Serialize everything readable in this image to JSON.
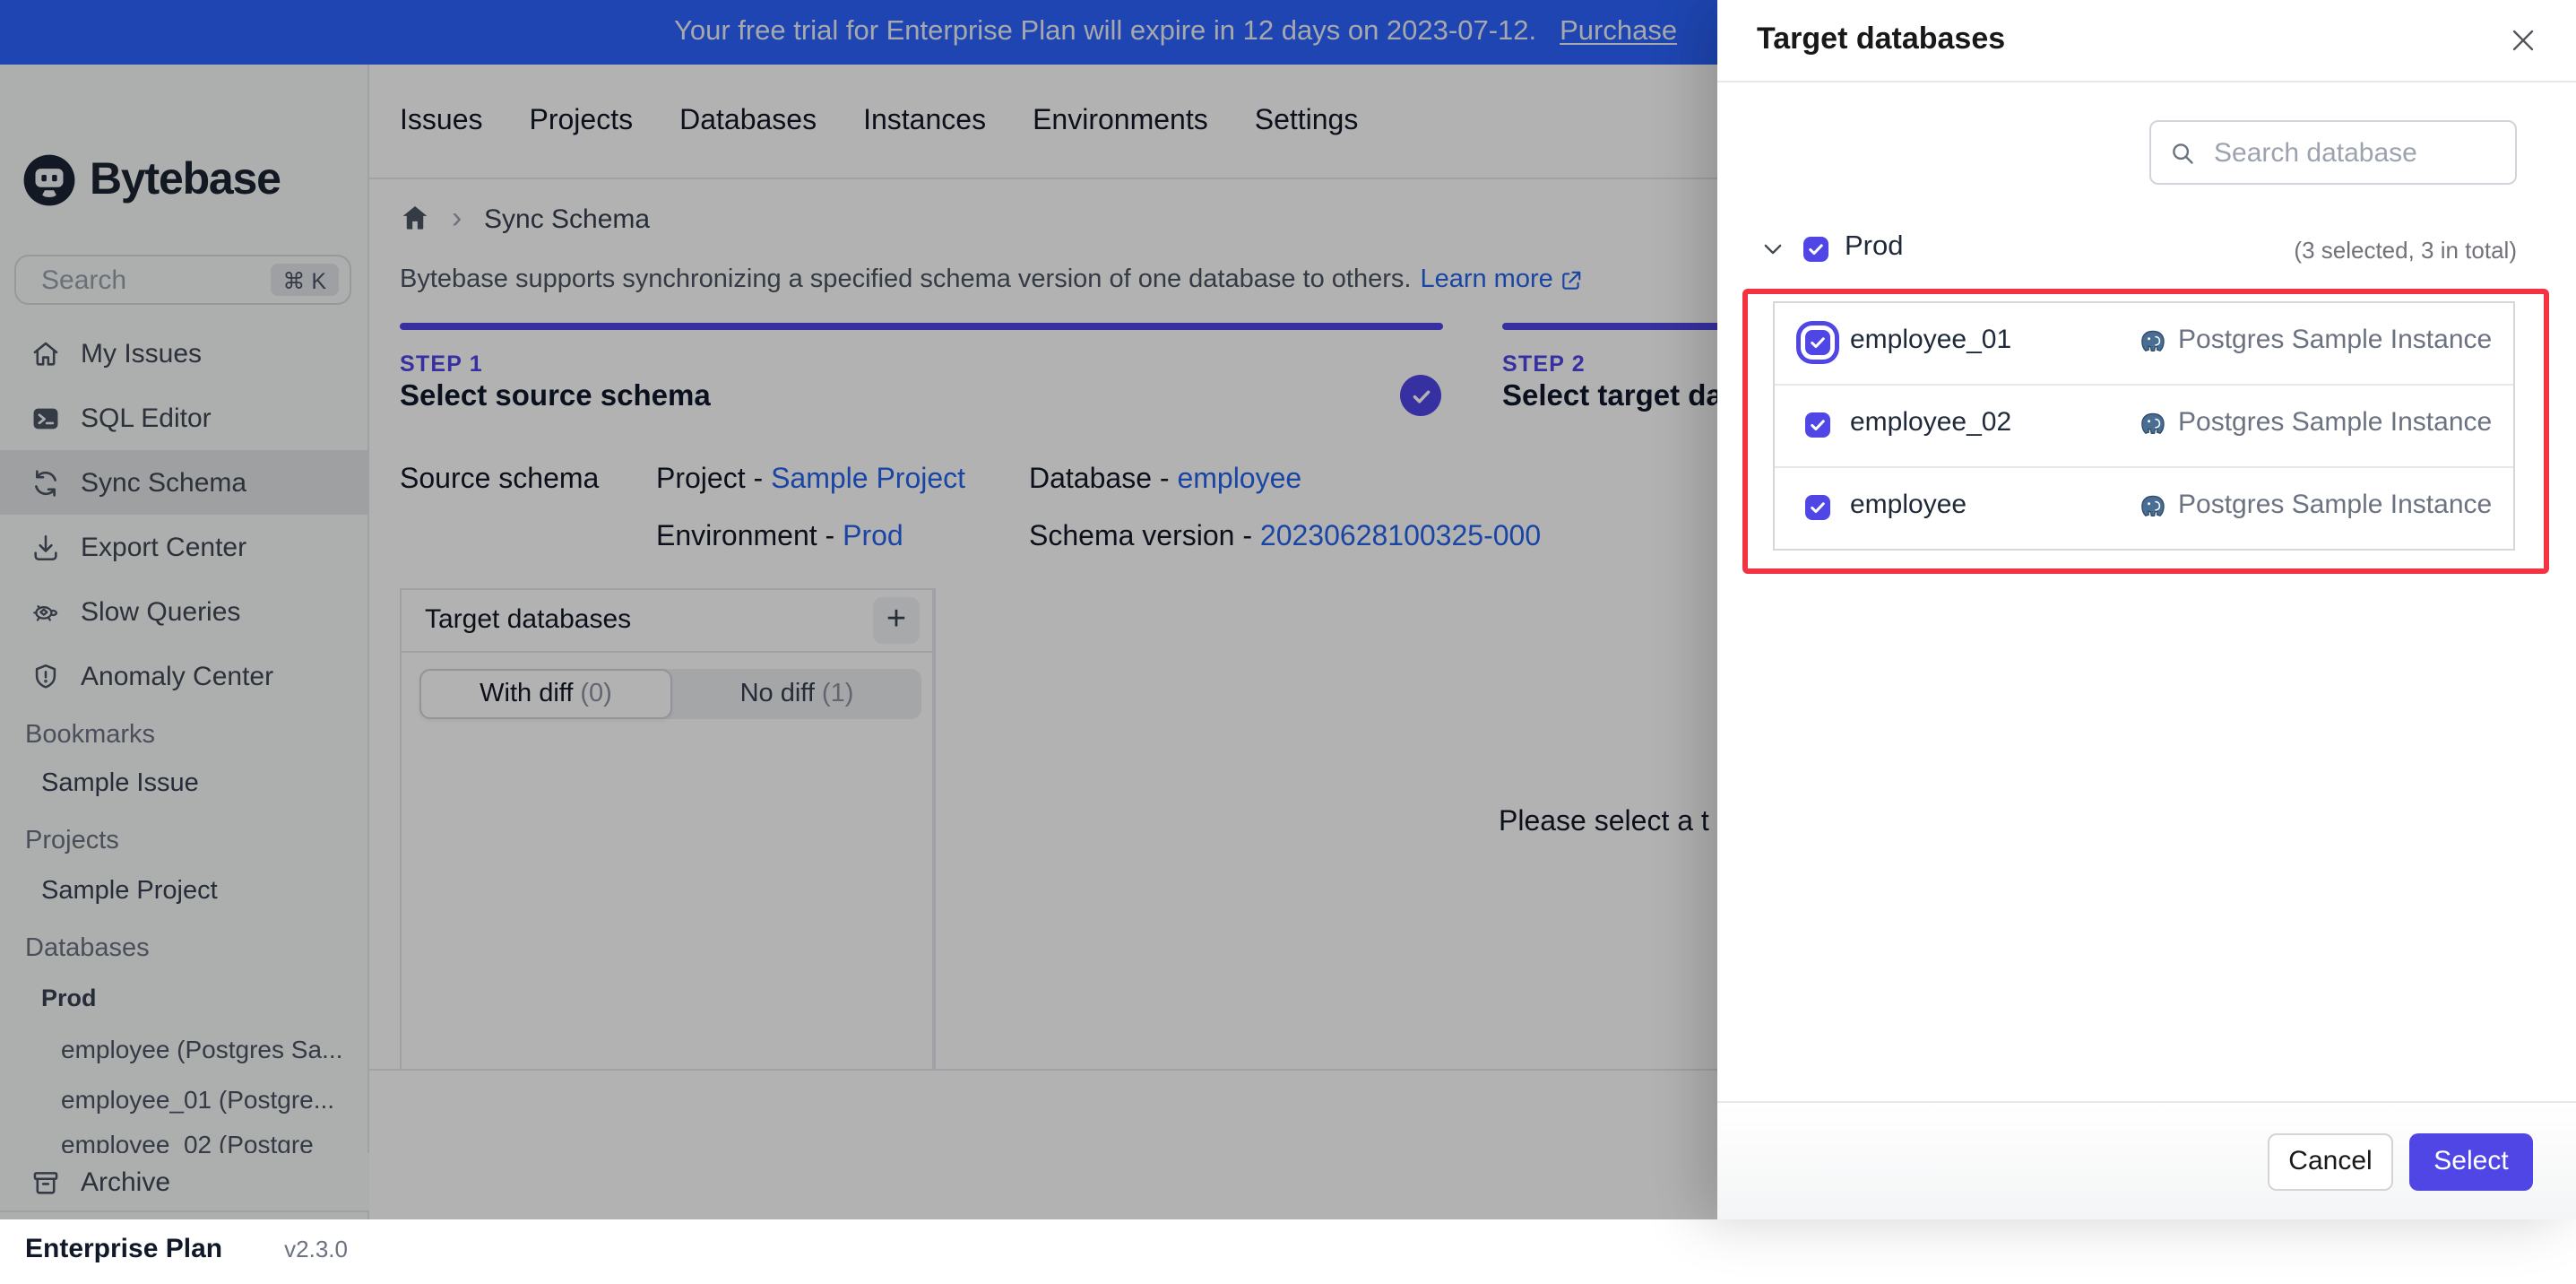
{
  "banner": {
    "message": "Your free trial for Enterprise Plan will expire in 12 days on 2023-07-12.",
    "link_label": "Purchase"
  },
  "sidebar": {
    "logo_text": "Bytebase",
    "search_placeholder": "Search",
    "shortcut": "⌘ K",
    "menu": [
      {
        "label": "My Issues",
        "icon": "home-icon"
      },
      {
        "label": "SQL Editor",
        "icon": "terminal-icon"
      },
      {
        "label": "Sync Schema",
        "icon": "sync-icon",
        "active": true
      },
      {
        "label": "Export Center",
        "icon": "download-icon"
      },
      {
        "label": "Slow Queries",
        "icon": "turtle-icon"
      },
      {
        "label": "Anomaly Center",
        "icon": "shield-icon"
      }
    ],
    "bookmarks_label": "Bookmarks",
    "bookmark_item": "Sample Issue",
    "projects_label": "Projects",
    "project_item": "Sample Project",
    "databases_label": "Databases",
    "environment": "Prod",
    "databases": [
      "employee (Postgres Sa...",
      "employee_01 (Postgre...",
      "employee_02 (Postgre"
    ],
    "archive_label": "Archive",
    "plan": "Enterprise Plan",
    "version": "v2.3.0"
  },
  "topnav": {
    "items": [
      "Issues",
      "Projects",
      "Databases",
      "Instances",
      "Environments",
      "Settings"
    ]
  },
  "breadcrumb": {
    "separator": "›",
    "page": "Sync Schema"
  },
  "page": {
    "description": "Bytebase supports synchronizing a specified schema version of one database to others.",
    "learn_more": "Learn more"
  },
  "steps": {
    "step1": {
      "label": "STEP 1",
      "title": "Select source schema"
    },
    "step2": {
      "label": "STEP 2",
      "title": "Select target databases"
    }
  },
  "source_schema": {
    "heading": "Source schema",
    "project_label": "Project -",
    "project": "Sample Project",
    "database_label": "Database -",
    "database": "employee",
    "environment_label": "Environment -",
    "environment": "Prod",
    "version_label": "Schema version -",
    "version": "20230628100325-000"
  },
  "target_panel": {
    "title": "Target databases",
    "add_label": "+",
    "tab_with_diff": "With diff",
    "tab_with_diff_count": "(0)",
    "tab_no_diff": "No diff",
    "tab_no_diff_count": "(1)",
    "empty_hint": "Please select a t"
  },
  "modal": {
    "title": "Target databases",
    "search_placeholder": "Search database",
    "group": {
      "name": "Prod",
      "count": "(3 selected, 3 in total)"
    },
    "rows": [
      {
        "name": "employee_01",
        "instance": "Postgres Sample Instance"
      },
      {
        "name": "employee_02",
        "instance": "Postgres Sample Instance"
      },
      {
        "name": "employee",
        "instance": "Postgres Sample Instance"
      }
    ],
    "footer": {
      "cancel": "Cancel",
      "select": "Select"
    }
  },
  "colors": {
    "accent": "#4f46e5",
    "link": "#2563eb",
    "banner": "#2b64ff",
    "highlight": "#f43342",
    "postgres": "#4a6d94"
  }
}
